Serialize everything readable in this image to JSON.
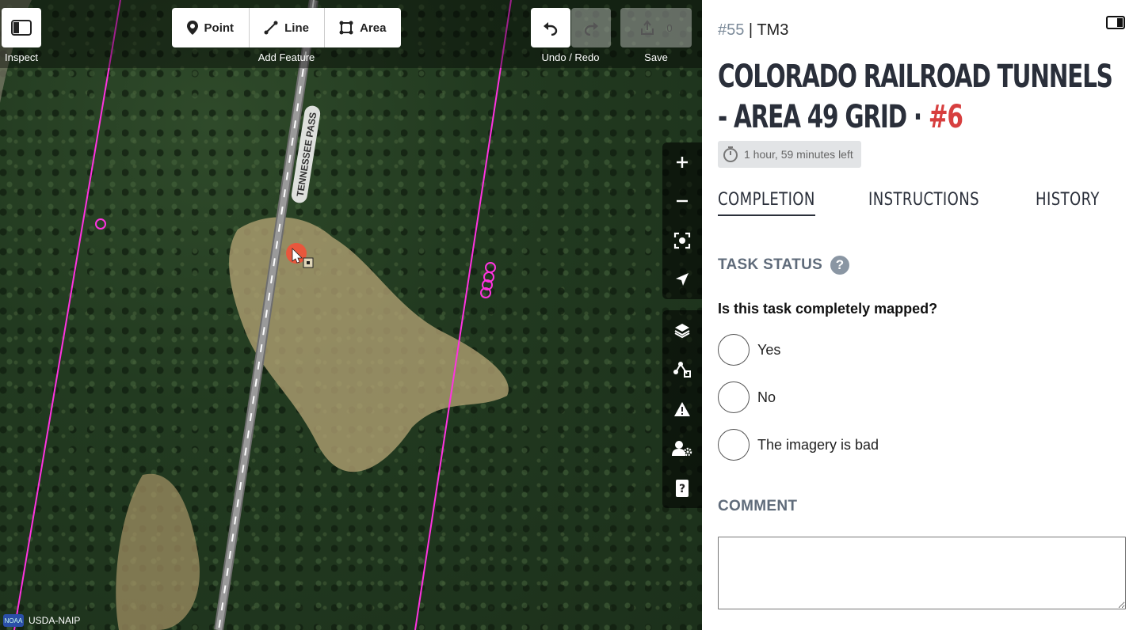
{
  "map": {
    "road_label": "TENNESSEE PASS",
    "attribution": "USDA-NAIP",
    "attribution_logo": "NOAA",
    "toolbar": {
      "inspect_label": "Inspect",
      "add_feature_label": "Add Feature",
      "point_label": "Point",
      "line_label": "Line",
      "area_label": "Area",
      "undo_redo_label": "Undo / Redo",
      "save_label": "Save",
      "save_count": "0"
    },
    "controls": [
      "zoom-in",
      "zoom-out",
      "zoom-to-selection",
      "geolocate",
      "layers",
      "map-data",
      "issues",
      "preferences",
      "help"
    ],
    "colors": {
      "task_boundary": "#ff33e0",
      "road": "#9a9a9a",
      "cursor_marker": "#e8573c"
    }
  },
  "sidebar": {
    "task_number": "#55",
    "separator": " | ",
    "project_short": "TM3",
    "title_main": "COLORADO RAILROAD TUNNELS - AREA 49 GRID · ",
    "title_task": "#6",
    "time_left": "1 hour, 59 minutes left",
    "tabs": [
      {
        "label": "COMPLETION",
        "active": true
      },
      {
        "label": "INSTRUCTIONS",
        "active": false
      },
      {
        "label": "HISTORY",
        "active": false
      }
    ],
    "task_status_heading": "TASK STATUS",
    "help_glyph": "?",
    "question": "Is this task completely mapped?",
    "options": [
      "Yes",
      "No",
      "The imagery is bad"
    ],
    "comment_heading": "COMMENT",
    "comment_value": "",
    "colors": {
      "accent": "#d73f3f",
      "heading": "#5f6b7a",
      "title": "#2a2f3a"
    }
  }
}
